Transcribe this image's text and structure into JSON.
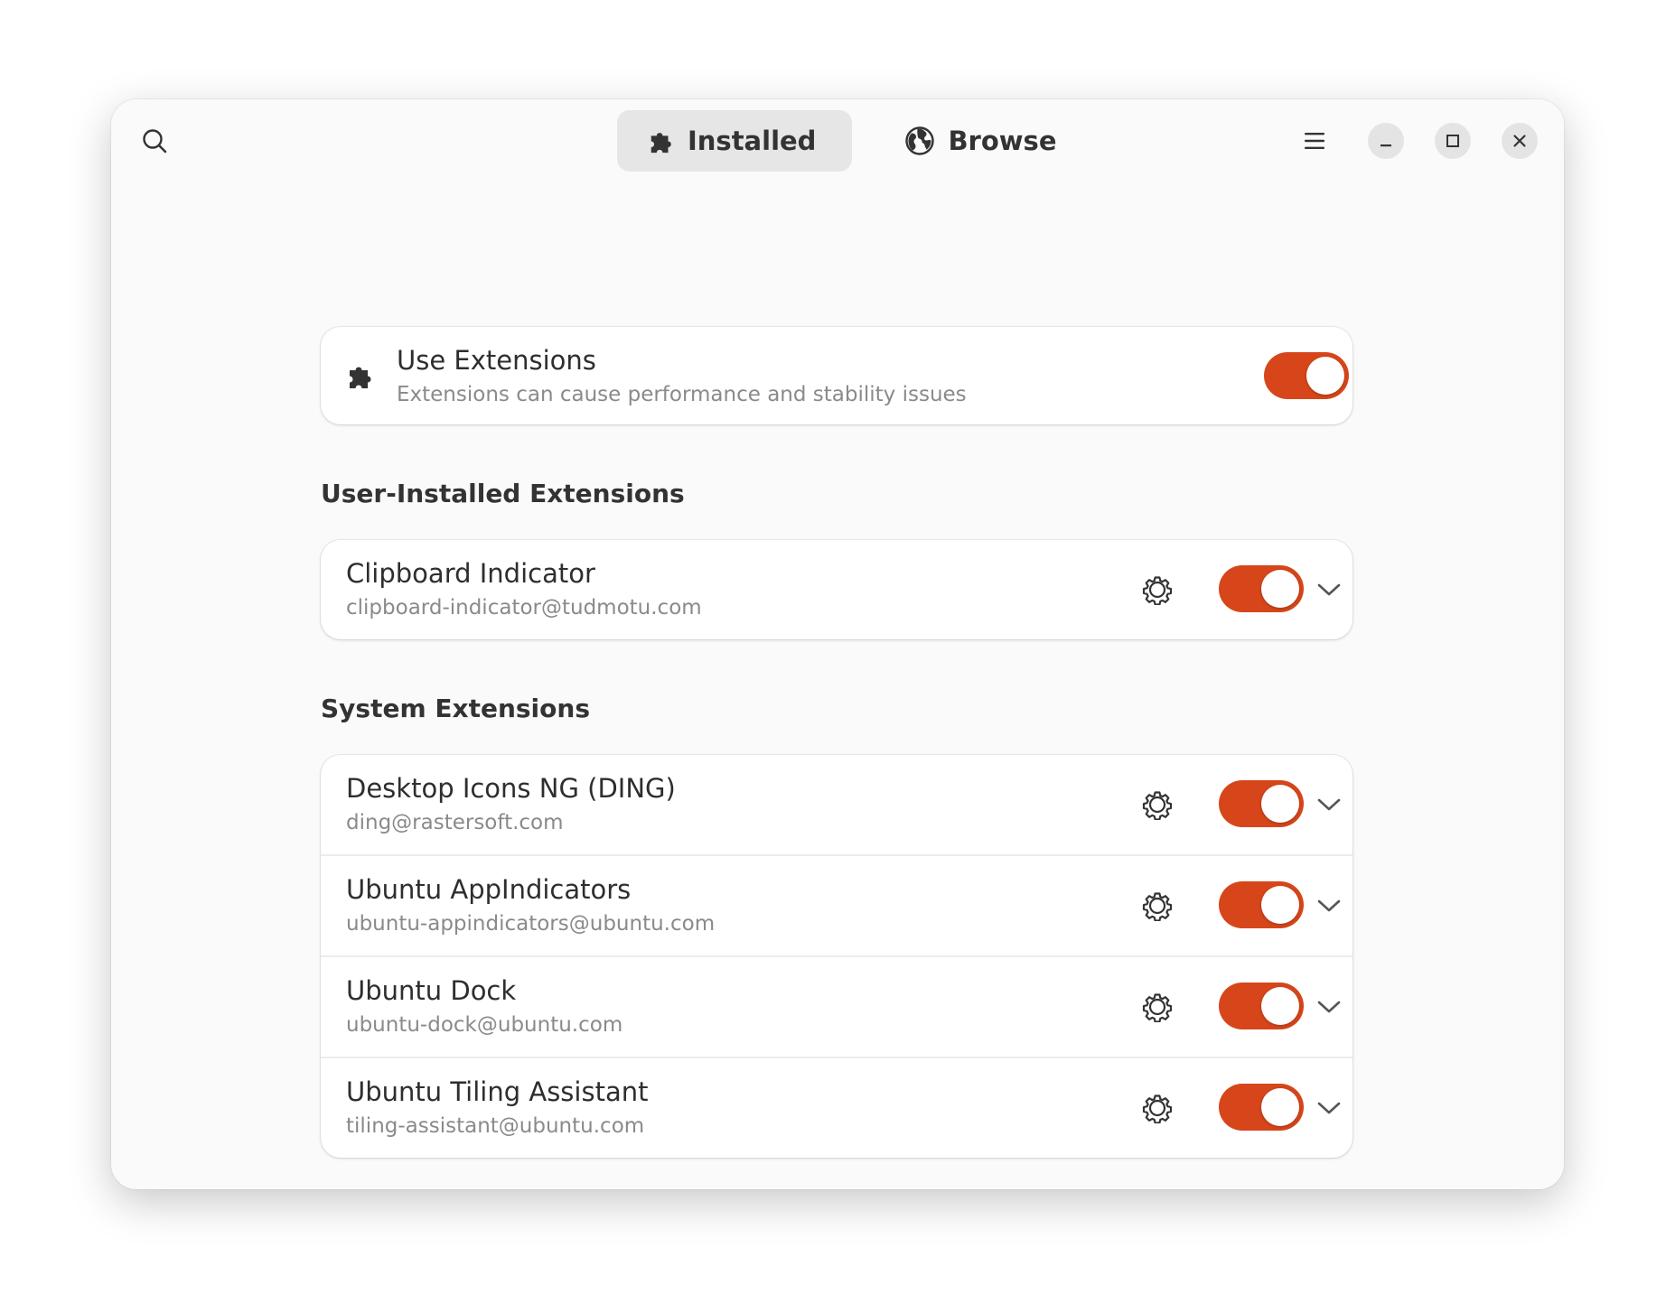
{
  "header": {
    "tabs": [
      {
        "label": "Installed",
        "icon": "puzzle-icon",
        "active": true
      },
      {
        "label": "Browse",
        "icon": "globe-icon",
        "active": false
      }
    ]
  },
  "use_extensions": {
    "title": "Use Extensions",
    "subtitle": "Extensions can cause performance and stability issues",
    "enabled": true
  },
  "sections": {
    "user": {
      "title": "User-Installed Extensions",
      "items": [
        {
          "name": "Clipboard Indicator",
          "uuid": "clipboard-indicator@tudmotu.com",
          "enabled": true
        }
      ]
    },
    "system": {
      "title": "System Extensions",
      "items": [
        {
          "name": "Desktop Icons NG (DING)",
          "uuid": "ding@rastersoft.com",
          "enabled": true
        },
        {
          "name": "Ubuntu AppIndicators",
          "uuid": "ubuntu-appindicators@ubuntu.com",
          "enabled": true
        },
        {
          "name": "Ubuntu Dock",
          "uuid": "ubuntu-dock@ubuntu.com",
          "enabled": true
        },
        {
          "name": "Ubuntu Tiling Assistant",
          "uuid": "tiling-assistant@ubuntu.com",
          "enabled": true
        }
      ]
    }
  },
  "colors": {
    "accent": "#d6461a",
    "window_bg": "#fafafa",
    "card_bg": "#ffffff",
    "subtitle": "#8a8a8a"
  }
}
